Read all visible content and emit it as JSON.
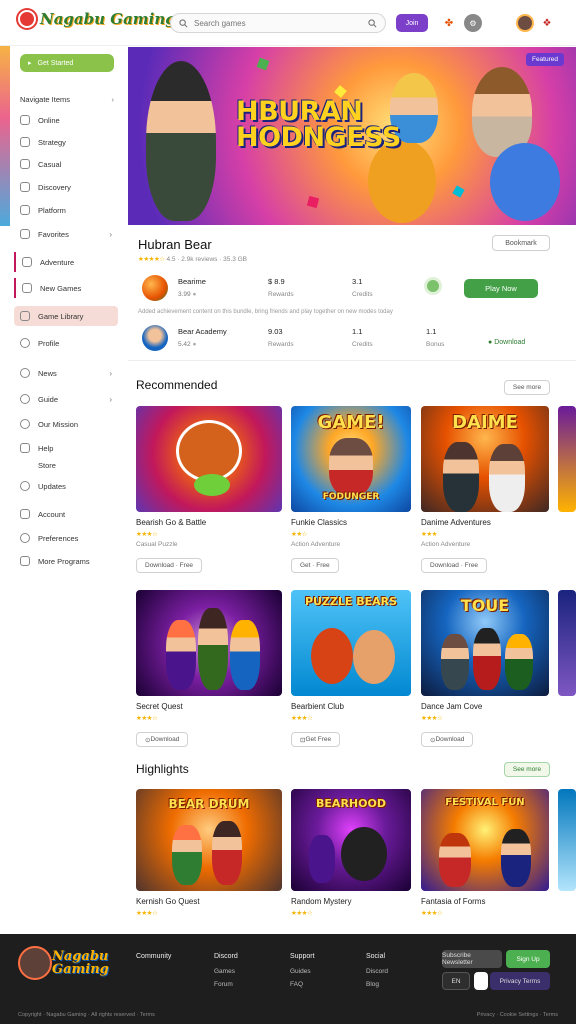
{
  "app": {
    "logo_text": "Nagabu Gaming",
    "search_placeholder": "Search games",
    "top_button": "Join"
  },
  "sidebar": {
    "green_pill": "Get Started",
    "section_header": "Navigate Items",
    "items": [
      {
        "label": "Online",
        "chevron": ""
      },
      {
        "label": "Strategy",
        "chevron": ""
      },
      {
        "label": "Casual",
        "chevron": ""
      },
      {
        "label": "Discovery",
        "chevron": ""
      },
      {
        "label": "Platform",
        "chevron": ""
      },
      {
        "label": "Favorites",
        "chevron": "›"
      },
      {
        "label": "Adventure",
        "chevron": ""
      },
      {
        "label": "New Games",
        "chevron": ""
      },
      {
        "label": "Game Library",
        "chevron": ""
      },
      {
        "label": "Profile",
        "chevron": ""
      },
      {
        "label": "News",
        "chevron": "›"
      },
      {
        "label": "Guide",
        "chevron": "›"
      },
      {
        "label": "Our Mission",
        "chevron": ""
      },
      {
        "label": "Help",
        "chevron": ""
      },
      {
        "label": "Store",
        "chevron": ""
      },
      {
        "label": "Updates",
        "chevron": ""
      },
      {
        "label": "Account",
        "chevron": ""
      },
      {
        "label": "Preferences",
        "chevron": ""
      },
      {
        "label": "More Programs",
        "chevron": ""
      }
    ]
  },
  "hero": {
    "title_line1": "HBURAN",
    "title_line2": "HODNGESS",
    "badge": "Featured"
  },
  "detail": {
    "title": "Hubran Bear",
    "rating_stars": "★★★★☆",
    "rating_text": "4.5 · 2.9k reviews · 35.3 GB",
    "share_button": "Bookmark",
    "rows": [
      {
        "name": "Bearime",
        "sub": "3.99",
        "c1": "$ 8.9",
        "c1s": "Rewards",
        "c2": "3.1",
        "c2s": "Credits",
        "c3": "",
        "c3s": ""
      },
      {
        "name": "Bear Academy",
        "sub": "5.42",
        "c1": "9.03",
        "c1s": "Rewards",
        "c2": "1.1",
        "c2s": "Credits",
        "c3": "1.1",
        "c3s": "Bonus"
      }
    ],
    "note": "Added achievement content on this bundle, bring friends and play together on new modes today",
    "play_button": "Play Now",
    "status_link": "Download"
  },
  "sections": [
    {
      "title": "Recommended",
      "button": "See more"
    },
    {
      "title": "Highlights",
      "button": "See more"
    }
  ],
  "cards_row1": [
    {
      "title": "Bearish Go & Battle",
      "stars": "★★★☆",
      "rate": "",
      "cat": "Casual Puzzle",
      "button": "Download · Free"
    },
    {
      "title": "Funkie Classics",
      "stars": "★★☆",
      "rate": "",
      "cat": "Action Adventure",
      "button": "Get · Free"
    },
    {
      "title": "Danime Adventures",
      "stars": "★★★",
      "rate": "",
      "cat": "Action Adventure",
      "button": "Download · Free"
    }
  ],
  "cards_row2": [
    {
      "title": "Secret Quest",
      "stars": "★★★☆",
      "rate": "",
      "cat": "",
      "button": "Download"
    },
    {
      "title": "Bearbient Club",
      "stars": "★★★☆",
      "rate": "",
      "cat": "",
      "button": "Get Free"
    },
    {
      "title": "Dance Jam Cove",
      "stars": "★★★☆",
      "rate": "",
      "cat": "",
      "button": "Download"
    }
  ],
  "cards_row3": [
    {
      "title": "Kernish Go Quest",
      "stars": "★★★☆",
      "rate": ""
    },
    {
      "title": "Random Mystery",
      "stars": "★★★☆",
      "rate": ""
    },
    {
      "title": "Fantasia of Forms",
      "stars": "★★★☆",
      "rate": ""
    }
  ],
  "thumb_texts": {
    "r1c2_top": "GAME!",
    "r1c2_bottom": "FODUNGER",
    "r1c3": "DAIME",
    "r2c2": "PUZZLE BEARS",
    "r2c3": "TOUE",
    "r3c1": "BEAR DRUM",
    "r3c2": "BEARHOOD",
    "r3c3": "FESTIVAL FUN"
  },
  "footer": {
    "logo_text": "Nagabu Gaming",
    "col1": {
      "head": "Community",
      "items": []
    },
    "col2": {
      "head": "Discord",
      "items": [
        "Games",
        "Forum"
      ]
    },
    "col3": {
      "head": "Support",
      "items": [
        "Guides",
        "FAQ"
      ]
    },
    "col4": {
      "head": "Social",
      "items": [
        "Discord",
        "Blog"
      ]
    },
    "btn_dark": "Subscribe Newsletter",
    "btn_green": "Sign Up",
    "lang": "EN",
    "btn_purple": "Privacy Terms",
    "bottom_left": "Copyright · Nagabu Gaming · All rights reserved · Terms",
    "bottom_right": "Privacy · Cookie Settings · Terms"
  },
  "colors": {
    "accent_purple": "#7b3fc9",
    "accent_green": "#43a047",
    "star": "#f5b400"
  }
}
